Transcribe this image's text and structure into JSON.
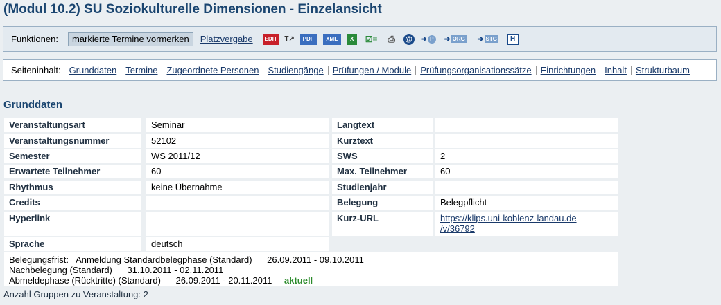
{
  "title": "(Modul 10.2) SU Soziokulturelle Dimensionen - Einzelansicht",
  "functions": {
    "label": "Funktionen:",
    "mark_button": "markierte Termine vormerken",
    "platzvergabe": "Platzvergabe",
    "icons": [
      "edit-icon",
      "text-tools-icon",
      "pdf-icon",
      "xml-icon",
      "excel-icon",
      "checklist-icon",
      "print-icon",
      "email-icon",
      "person-link-icon",
      "org-link-icon",
      "stg-link-icon",
      "help-icon"
    ]
  },
  "nav": {
    "label": "Seiteninhalt:",
    "items": [
      "Grunddaten",
      "Termine",
      "Zugeordnete Personen",
      "Studiengänge",
      "Prüfungen / Module",
      "Prüfungsorganisationssätze",
      "Einrichtungen",
      "Inhalt",
      "Strukturbaum"
    ]
  },
  "section_title": "Grunddaten",
  "rows": [
    {
      "l1": "Veranstaltungsart",
      "v1": "Seminar",
      "l2": "Langtext",
      "v2": ""
    },
    {
      "l1": "Veranstaltungsnummer",
      "v1": "52102",
      "l2": "Kurztext",
      "v2": ""
    },
    {
      "l1": "Semester",
      "v1": "WS 2011/12",
      "l2": "SWS",
      "v2": "2"
    },
    {
      "l1": "Erwartete Teilnehmer",
      "v1": "60",
      "l2": "Max. Teilnehmer",
      "v2": "60"
    },
    {
      "l1": "Rhythmus",
      "v1": "keine Übernahme",
      "l2": "Studienjahr",
      "v2": ""
    },
    {
      "l1": "Credits",
      "v1": "",
      "l2": "Belegung",
      "v2": "Belegpflicht"
    },
    {
      "l1": "Hyperlink",
      "v1": "",
      "l2": "Kurz-URL",
      "v2_line1": "https://klips.uni-koblenz-landau.de",
      "v2_line2": "/v/36792"
    },
    {
      "l1": "Sprache",
      "v1": "deutsch"
    }
  ],
  "belegung": {
    "label": "Belegungsfrist:",
    "phases": [
      {
        "name": "Anmeldung Standardbelegphase (Standard)",
        "range": "26.09.2011 - 09.10.2011"
      },
      {
        "name": "Nachbelegung (Standard)",
        "range": "31.10.2011 - 02.11.2011"
      },
      {
        "name": "Abmeldephase (Rücktritte) (Standard)",
        "range": "26.09.2011 - 20.11.2011",
        "status": "aktuell"
      }
    ]
  },
  "footer": "Anzahl Gruppen zu Veranstaltung: 2",
  "colors": {
    "title": "#1a4570",
    "link": "#1a3a6a",
    "aktuell": "#2a8a2a",
    "background": "#ebeff2"
  }
}
